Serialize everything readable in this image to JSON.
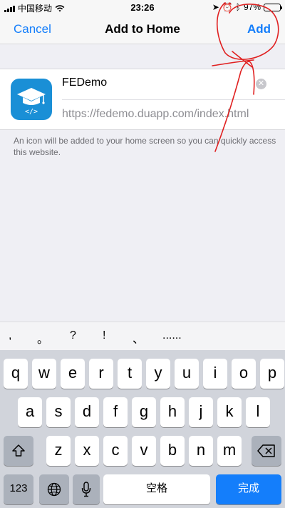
{
  "status_bar": {
    "carrier": "中国移动",
    "time": "23:26",
    "battery": "97%",
    "battery_level": 0.97
  },
  "nav": {
    "cancel_label": "Cancel",
    "title": "Add to Home",
    "add_label": "Add"
  },
  "form": {
    "name_value": "FEDemo",
    "url": "https://fedemo.duapp.com/index.html",
    "icon_code_text": "</>"
  },
  "description": "An icon will be added to your home screen so you can quickly access this website.",
  "candidates": [
    ",",
    "。",
    "?",
    "!",
    "、",
    "......"
  ],
  "keyboard": {
    "row1": [
      "q",
      "w",
      "e",
      "r",
      "t",
      "y",
      "u",
      "i",
      "o",
      "p"
    ],
    "row2": [
      "a",
      "s",
      "d",
      "f",
      "g",
      "h",
      "j",
      "k",
      "l"
    ],
    "row3": [
      "z",
      "x",
      "c",
      "v",
      "b",
      "n",
      "m"
    ],
    "numbers_label": "123",
    "space_label": "空格",
    "done_label": "完成"
  },
  "colors": {
    "accent": "#147efb",
    "annotation": "#e02020",
    "app_icon_bg": "#1a8fd6"
  }
}
